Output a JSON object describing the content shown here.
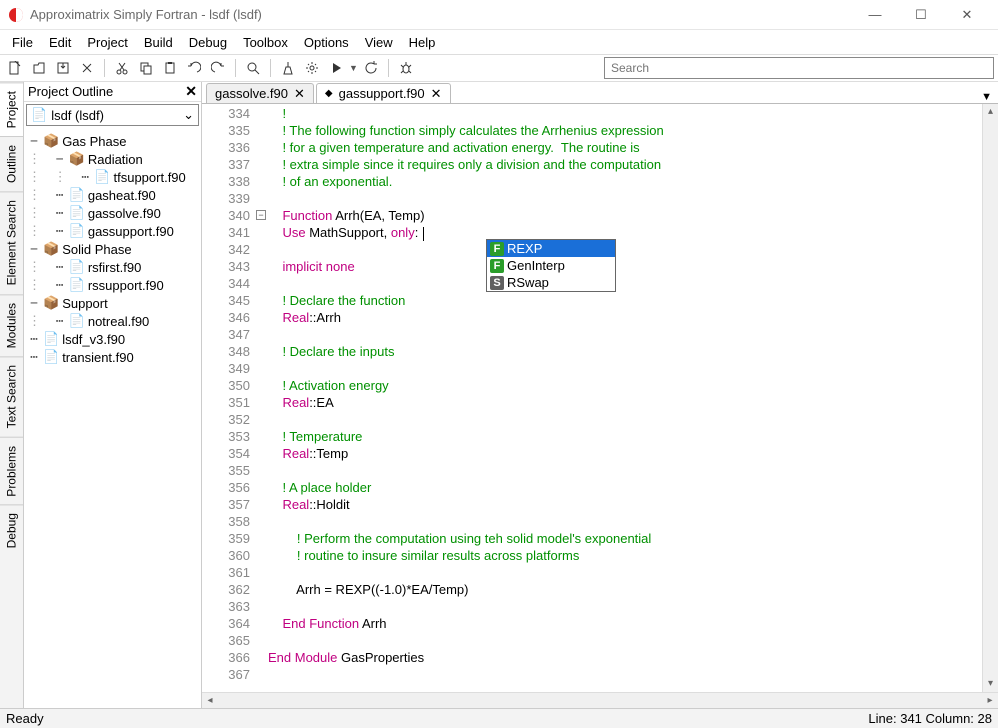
{
  "window": {
    "title": "Approximatrix Simply Fortran - lsdf (lsdf)"
  },
  "menubar": [
    "File",
    "Edit",
    "Project",
    "Build",
    "Debug",
    "Toolbox",
    "Options",
    "View",
    "Help"
  ],
  "search": {
    "placeholder": "Search"
  },
  "sidetabs": [
    "Project",
    "Outline",
    "Element Search",
    "Modules",
    "Text Search",
    "Problems",
    "Debug"
  ],
  "outline": {
    "title": "Project Outline",
    "selector": "lsdf (lsdf)",
    "selector_icon": "📄",
    "tree": [
      {
        "indent": 0,
        "twist": "−",
        "icon": "📦",
        "label": "Gas Phase"
      },
      {
        "indent": 1,
        "twist": "−",
        "icon": "📦",
        "label": "Radiation"
      },
      {
        "indent": 2,
        "twist": "",
        "icon": "📄",
        "label": "tfsupport.f90"
      },
      {
        "indent": 1,
        "twist": "",
        "icon": "📄",
        "label": "gasheat.f90"
      },
      {
        "indent": 1,
        "twist": "",
        "icon": "📄",
        "label": "gassolve.f90"
      },
      {
        "indent": 1,
        "twist": "",
        "icon": "📄",
        "label": "gassupport.f90"
      },
      {
        "indent": 0,
        "twist": "−",
        "icon": "📦",
        "label": "Solid Phase"
      },
      {
        "indent": 1,
        "twist": "",
        "icon": "📄",
        "label": "rsfirst.f90"
      },
      {
        "indent": 1,
        "twist": "",
        "icon": "📄",
        "label": "rssupport.f90"
      },
      {
        "indent": 0,
        "twist": "−",
        "icon": "📦",
        "label": "Support"
      },
      {
        "indent": 1,
        "twist": "",
        "icon": "📄",
        "label": "notreal.f90"
      },
      {
        "indent": 0,
        "twist": "",
        "icon": "📄",
        "label": "lsdf_v3.f90"
      },
      {
        "indent": 0,
        "twist": "",
        "icon": "📄",
        "label": "transient.f90"
      }
    ]
  },
  "tabs": [
    {
      "label": "gassolve.f90",
      "active": false
    },
    {
      "label": "gassupport.f90",
      "active": true,
      "bullet": "◆"
    }
  ],
  "code": {
    "first_line": 334,
    "fold_at": 340,
    "lines": [
      {
        "segs": [
          [
            "c",
            "    !"
          ]
        ]
      },
      {
        "segs": [
          [
            "c",
            "    ! The following function simply calculates the Arrhenius expression"
          ]
        ]
      },
      {
        "segs": [
          [
            "c",
            "    ! for a given temperature and activation energy.  The routine is"
          ]
        ]
      },
      {
        "segs": [
          [
            "c",
            "    ! extra simple since it requires only a division and the computation"
          ]
        ]
      },
      {
        "segs": [
          [
            "c",
            "    ! of an exponential."
          ]
        ]
      },
      {
        "segs": []
      },
      {
        "segs": [
          [
            "k",
            "    Function "
          ],
          [
            "p",
            "Arrh(EA, Temp)"
          ]
        ]
      },
      {
        "segs": [
          [
            "k",
            "    Use "
          ],
          [
            "p",
            "MathSupport, "
          ],
          [
            "k",
            "only"
          ],
          [
            "p",
            ": "
          ]
        ],
        "cursor": true
      },
      {
        "segs": []
      },
      {
        "segs": [
          [
            "k",
            "    implicit none"
          ]
        ]
      },
      {
        "segs": []
      },
      {
        "segs": [
          [
            "c",
            "    ! Declare the function"
          ]
        ]
      },
      {
        "segs": [
          [
            "k",
            "    Real"
          ],
          [
            "p",
            "::Arrh"
          ]
        ]
      },
      {
        "segs": []
      },
      {
        "segs": [
          [
            "c",
            "    ! Declare the inputs"
          ]
        ]
      },
      {
        "segs": []
      },
      {
        "segs": [
          [
            "c",
            "    ! Activation energy"
          ]
        ]
      },
      {
        "segs": [
          [
            "k",
            "    Real"
          ],
          [
            "p",
            "::EA"
          ]
        ]
      },
      {
        "segs": []
      },
      {
        "segs": [
          [
            "c",
            "    ! Temperature"
          ]
        ]
      },
      {
        "segs": [
          [
            "k",
            "    Real"
          ],
          [
            "p",
            "::Temp"
          ]
        ]
      },
      {
        "segs": []
      },
      {
        "segs": [
          [
            "c",
            "    ! A place holder"
          ]
        ]
      },
      {
        "segs": [
          [
            "k",
            "    Real"
          ],
          [
            "p",
            "::Holdit"
          ]
        ]
      },
      {
        "segs": []
      },
      {
        "segs": [
          [
            "c",
            "        ! Perform the computation using teh solid model's exponential"
          ]
        ]
      },
      {
        "segs": [
          [
            "c",
            "        ! routine to insure similar results across platforms"
          ]
        ]
      },
      {
        "segs": []
      },
      {
        "segs": [
          [
            "p",
            "        Arrh = REXP((-1.0)*EA/Temp)"
          ]
        ]
      },
      {
        "segs": []
      },
      {
        "segs": [
          [
            "k",
            "    End Function "
          ],
          [
            "p",
            "Arrh"
          ]
        ]
      },
      {
        "segs": []
      },
      {
        "segs": [
          [
            "k",
            "End Module "
          ],
          [
            "p",
            "GasProperties"
          ]
        ]
      },
      {
        "segs": []
      }
    ]
  },
  "autocomplete": {
    "items": [
      {
        "badge": "F",
        "label": "REXP",
        "selected": true
      },
      {
        "badge": "F",
        "label": "GenInterp",
        "selected": false
      },
      {
        "badge": "S",
        "label": "RSwap",
        "selected": false
      }
    ]
  },
  "status": {
    "left": "Ready",
    "right": "Line: 341 Column: 28"
  }
}
